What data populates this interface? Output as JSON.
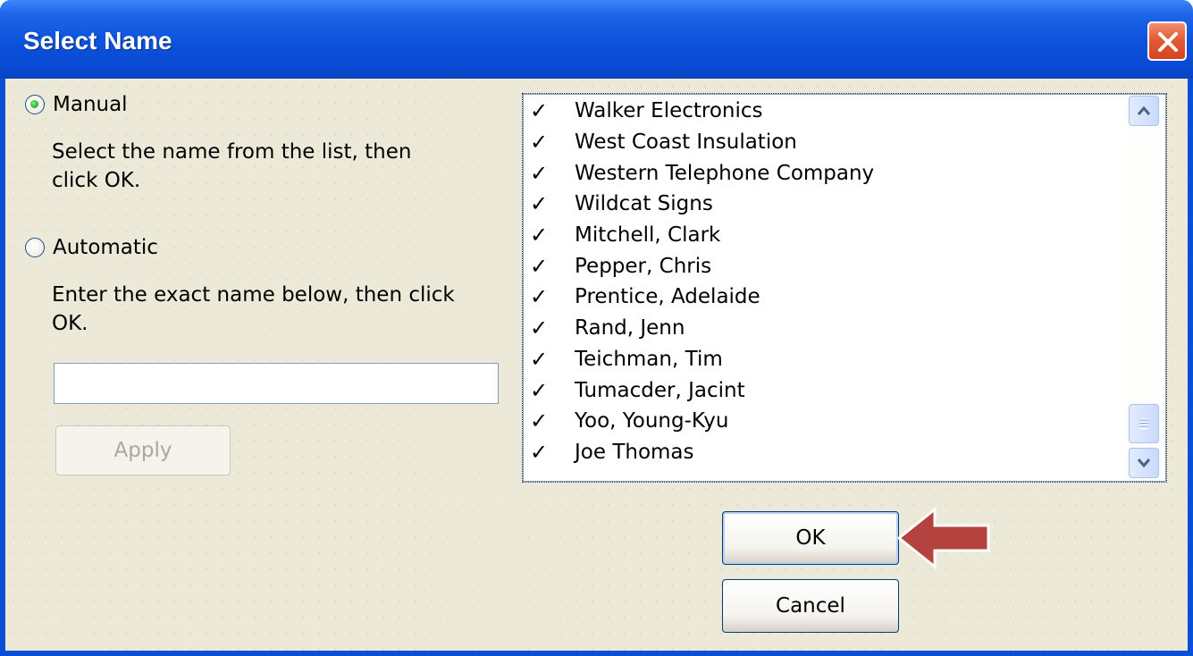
{
  "window": {
    "title": "Select Name",
    "close_icon": "close-icon"
  },
  "options": {
    "manual": {
      "label": "Manual",
      "selected": true,
      "description_line1": "Select the name from the list, then",
      "description_line2": "click OK."
    },
    "automatic": {
      "label": "Automatic",
      "selected": false,
      "description_line1": "Enter the exact name below, then click",
      "description_line2": "OK."
    }
  },
  "name_input": {
    "value": "",
    "placeholder": ""
  },
  "apply_button": {
    "label": "Apply",
    "enabled": false
  },
  "names_list": {
    "check_glyph": "✓",
    "items": [
      "Walker Electronics",
      "West Coast Insulation",
      "Western Telephone Company",
      "Wildcat Signs",
      "Mitchell, Clark",
      "Pepper, Chris",
      "Prentice, Adelaide",
      "Rand, Jenn",
      "Teichman, Tim",
      "Tumacder, Jacint",
      "Yoo, Young-Kyu",
      "Joe Thomas"
    ]
  },
  "ok_button": {
    "label": "OK"
  },
  "cancel_button": {
    "label": "Cancel"
  },
  "colors": {
    "title_bar": "#0a52dc",
    "dialog_bg": "#ece9d8",
    "arrow": "#b4423e"
  }
}
